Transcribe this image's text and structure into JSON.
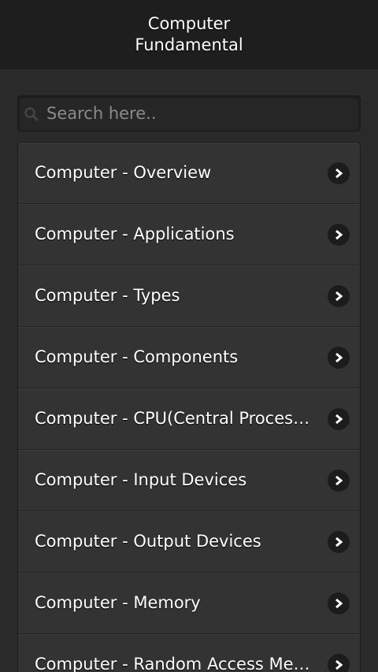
{
  "header": {
    "title": "Computer Fundamental"
  },
  "search": {
    "placeholder": "Search here..",
    "value": ""
  },
  "list": {
    "items": [
      {
        "label": "Computer - Overview"
      },
      {
        "label": "Computer - Applications"
      },
      {
        "label": "Computer - Types"
      },
      {
        "label": "Computer - Components"
      },
      {
        "label": "Computer - CPU(Central Processi..."
      },
      {
        "label": "Computer - Input Devices"
      },
      {
        "label": "Computer - Output Devices"
      },
      {
        "label": "Computer - Memory"
      },
      {
        "label": "Computer - Random Access Mem..."
      }
    ]
  },
  "icons": {
    "search": "search-icon",
    "chevron": "chevron-right-icon"
  },
  "colors": {
    "background": "#2a2a2a",
    "header": "#1e1e1e",
    "list_item": "#333333",
    "text": "#ffffff"
  }
}
